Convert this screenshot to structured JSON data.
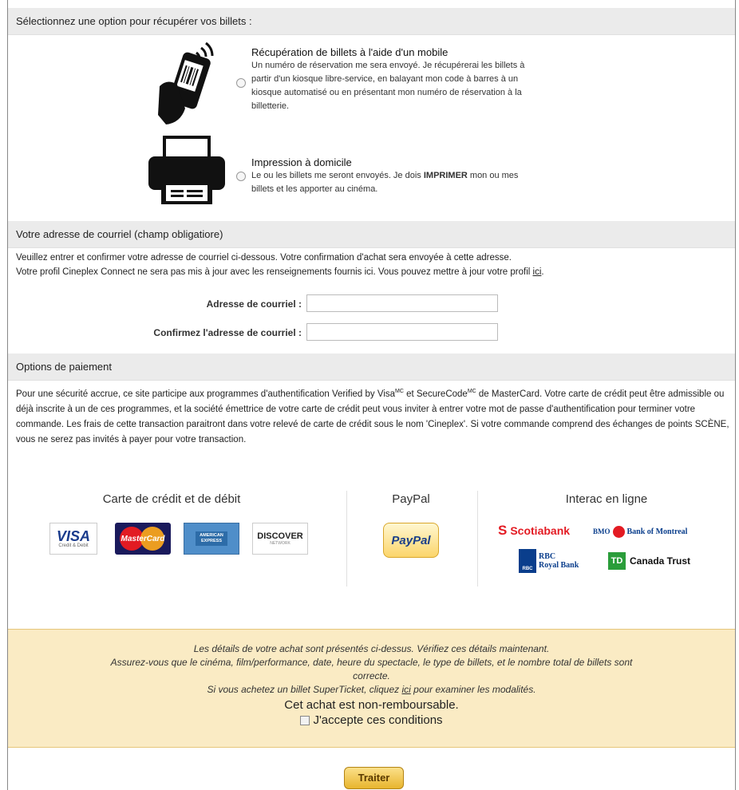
{
  "sections": {
    "retrieve_header": "Sélectionnez une option pour récupérer vos billets :",
    "email_header": "Votre adresse de courriel (champ obligatiore)",
    "payment_header": "Options de paiement"
  },
  "delivery_options": [
    {
      "title": "Récupération de billets à l'aide d'un mobile",
      "desc_lines": [
        "Un numéro de réservation me sera envoyé. Je récupérerai les billets à",
        "partir d'un kiosque libre-service, en balayant mon code à barres à un",
        "kiosque automatisé ou en présentant mon numéro de réservation à la",
        "billetterie."
      ],
      "icon": "mobile-phone-icon"
    },
    {
      "title": "Impression à domicile",
      "desc_pre": "Le ou les billets me seront envoyés. Je dois ",
      "desc_bold": "IMPRIMER",
      "desc_post": " mon ou mes",
      "desc_line2": "billets et les apporter au cinéma.",
      "icon": "printer-icon"
    }
  ],
  "email": {
    "intro_line1": "Veuillez entrer et confirmer votre adresse de courriel ci-dessous. Votre confirmation d'achat sera envoyée à cette adresse.",
    "intro_line2_pre": "Votre profil Cineplex Connect ne sera pas mis à jour avec les renseignements fournis ici. Vous pouvez mettre à jour votre profil ",
    "intro_link": "ici",
    "intro_line2_post": ".",
    "email_label": "Adresse de courriel :",
    "confirm_label": "Confirmez l'adresse de courriel :",
    "email_value": "",
    "confirm_value": ""
  },
  "payment": {
    "text_a": "Pour une sécurité accrue, ce site participe aux programmes d'authentification Verified by Visa",
    "sup_mc": "MC",
    "text_b": " et SecureCode",
    "text_c": " de MasterCard. Votre carte de crédit peut être admissible ou déjà inscrite à un de ces programmes, et la société émettrice de votre carte de crédit peut vous inviter à entrer votre mot de passe d'authentification pour terminer votre commande. Les frais de cette transaction paraitront dans votre relevé de carte de crédit sous le nom 'Cineplex'. Si votre commande comprend des échanges de points SCÈNE, vous ne serez pas invités à payer pour votre transaction.",
    "col_cards": "Carte de crédit et de débit",
    "col_paypal": "PayPal",
    "col_interac": "Interac en ligne",
    "cards": {
      "visa": "VISA",
      "visa_sub": "Credit & Debit",
      "mastercard": "MasterCard",
      "amex": "AMERICAN EXPRESS",
      "discover": "DISCOVER",
      "discover_sub": "NETWORK",
      "paypal": "PayPal"
    },
    "banks": {
      "scotia": "Scotiabank",
      "bmo_short": "BMO",
      "bmo_long": "Bank of Montreal",
      "rbc_short": "RBC",
      "rbc_long1": "RBC",
      "rbc_long2": "Royal Bank",
      "td_short": "TD",
      "td_long": "Canada Trust"
    }
  },
  "terms": {
    "line1": "Les détails de votre achat sont présentés ci-dessus. Vérifiez ces détails maintenant.",
    "line2": "Assurez-vous que le cinéma, film/performance, date, heure du spectacle, le type de billets, et le nombre total de billets sont",
    "line3": "correcte.",
    "line4_pre": "Si vous achetez un billet SuperTicket, cliquez ",
    "line4_link": "ici",
    "line4_post": " pour examiner les modalités.",
    "nonrefundable": "Cet achat est non-remboursable.",
    "accept_label": "J'accepte ces conditions"
  },
  "submit_label": "Traiter"
}
